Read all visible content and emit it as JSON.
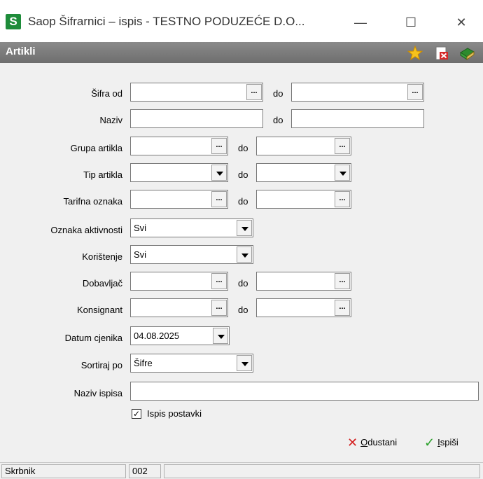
{
  "window": {
    "app_icon_letter": "S",
    "title": "Saop Šifrarnici – ispis - TESTNO PODUZEĆE D.O...",
    "minimize_glyph": "—",
    "maximize_glyph": "☐",
    "close_glyph": "✕"
  },
  "header": {
    "title": "Artikli",
    "icons": [
      "star-icon",
      "delete-document-icon",
      "book-icon"
    ]
  },
  "form": {
    "sifra_label": "Šifra od",
    "naziv_label": "Naziv",
    "grupa_label": "Grupa artikla",
    "tip_label": "Tip artikla",
    "tarifna_label": "Tarifna oznaka",
    "aktivnost_label": "Oznaka aktivnosti",
    "aktivnost_value": "Svi",
    "koristenje_label": "Korištenje",
    "koristenje_value": "Svi",
    "dobavljac_label": "Dobavljač",
    "konsignant_label": "Konsignant",
    "datum_label": "Datum cjenika",
    "datum_value": "04.08.2025",
    "sortiraj_label": "Sortiraj po",
    "sortiraj_value": "Šifre",
    "naziv_ispisa_label": "Naziv ispisa",
    "naziv_ispisa_value": "",
    "do_label": "do",
    "lookup_glyph": "...",
    "ispis_postavki_label": "Ispis postavki",
    "ispis_postavki_checked": true
  },
  "buttons": {
    "odustani_prefix": "",
    "odustani_u": "O",
    "odustani_rest": "dustani",
    "ispisi_u": "I",
    "ispisi_rest": "spiši"
  },
  "status": {
    "user": "Skrbnik",
    "code": "002",
    "extra": ""
  }
}
